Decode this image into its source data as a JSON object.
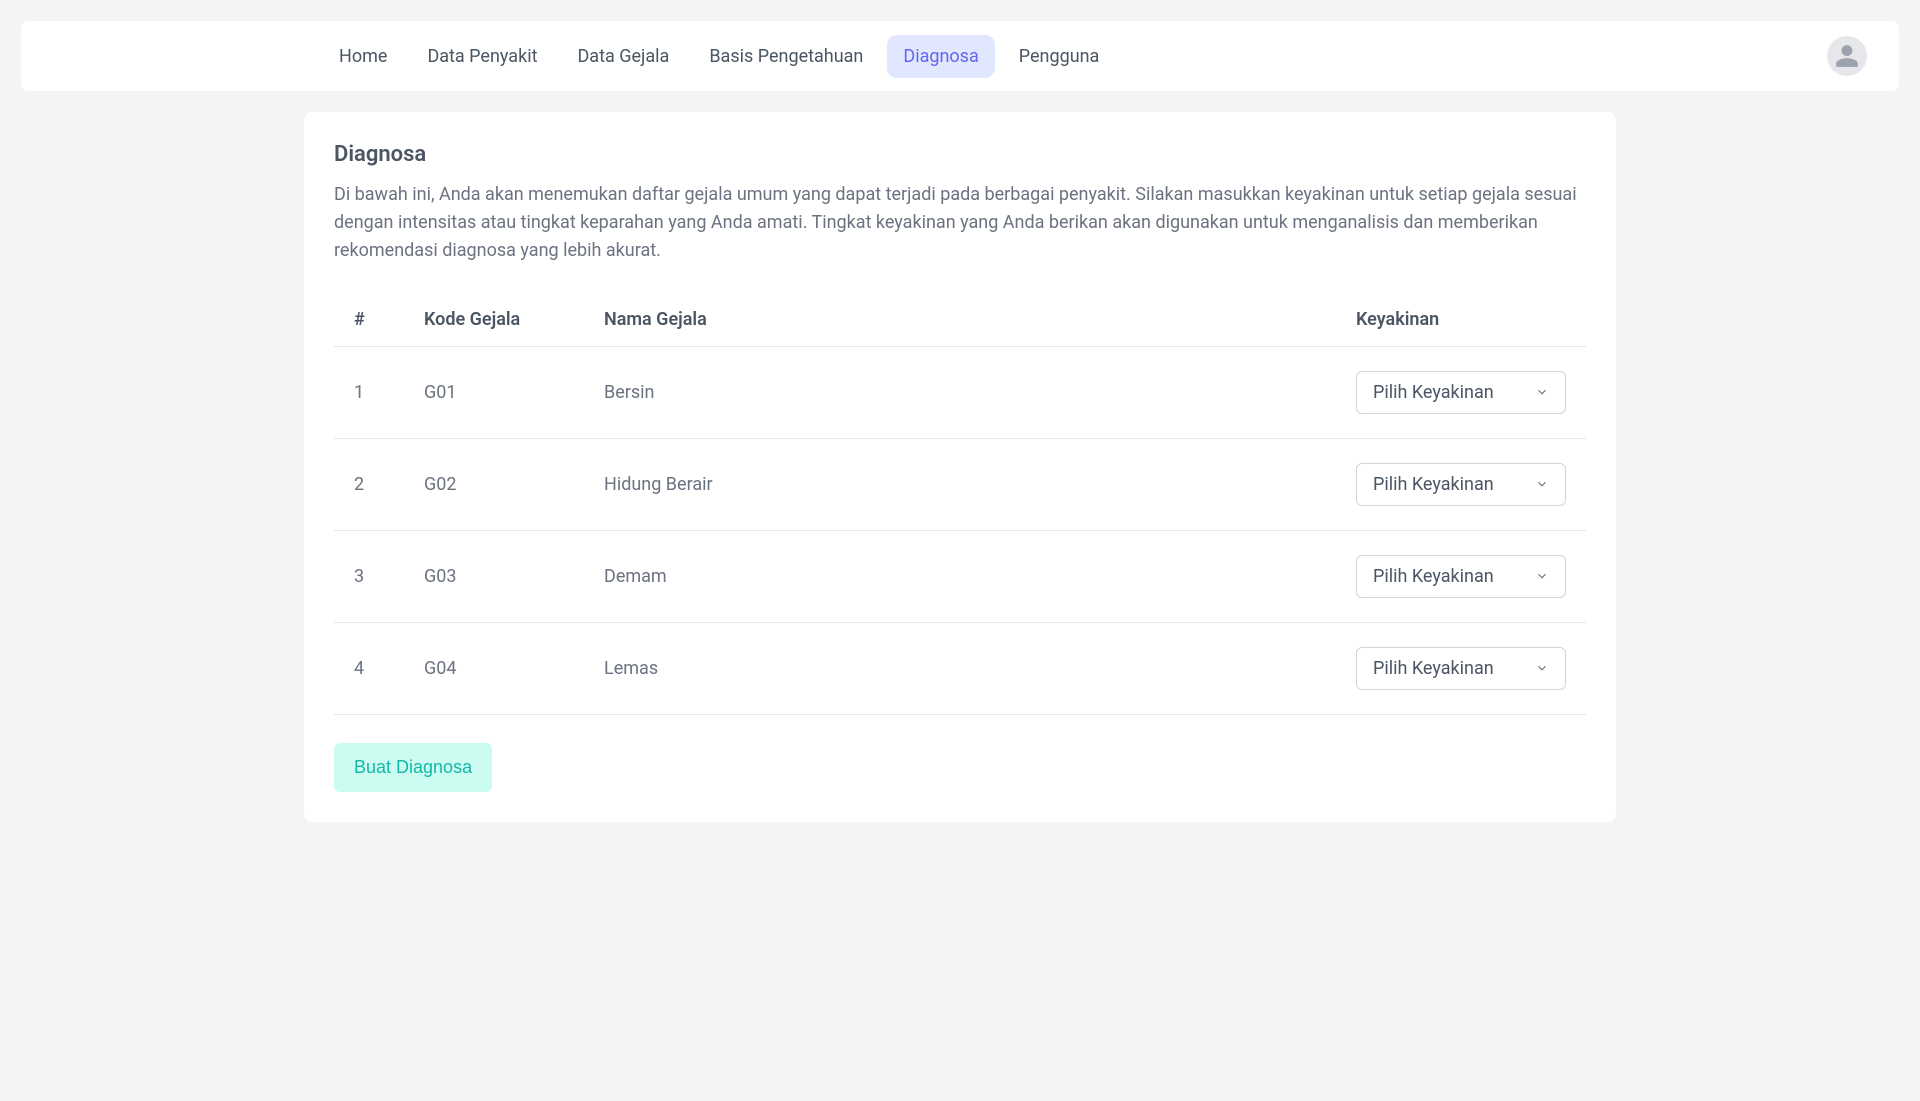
{
  "nav": {
    "items": [
      {
        "label": "Home",
        "active": false
      },
      {
        "label": "Data Penyakit",
        "active": false
      },
      {
        "label": "Data Gejala",
        "active": false
      },
      {
        "label": "Basis Pengetahuan",
        "active": false
      },
      {
        "label": "Diagnosa",
        "active": true
      },
      {
        "label": "Pengguna",
        "active": false
      }
    ]
  },
  "page": {
    "title": "Diagnosa",
    "description": "Di bawah ini, Anda akan menemukan daftar gejala umum yang dapat terjadi pada berbagai penyakit. Silakan masukkan keyakinan untuk setiap gejala sesuai dengan intensitas atau tingkat keparahan yang Anda amati. Tingkat keyakinan yang Anda berikan akan digunakan untuk menganalisis dan memberikan rekomendasi diagnosa yang lebih akurat."
  },
  "table": {
    "headers": {
      "idx": "#",
      "kode": "Kode Gejala",
      "nama": "Nama Gejala",
      "keyakinan": "Keyakinan"
    },
    "rows": [
      {
        "idx": "1",
        "kode": "G01",
        "nama": "Bersin",
        "select": "Pilih Keyakinan"
      },
      {
        "idx": "2",
        "kode": "G02",
        "nama": "Hidung Berair",
        "select": "Pilih Keyakinan"
      },
      {
        "idx": "3",
        "kode": "G03",
        "nama": "Demam",
        "select": "Pilih Keyakinan"
      },
      {
        "idx": "4",
        "kode": "G04",
        "nama": "Lemas",
        "select": "Pilih Keyakinan"
      }
    ]
  },
  "submit": {
    "label": "Buat Diagnosa"
  }
}
